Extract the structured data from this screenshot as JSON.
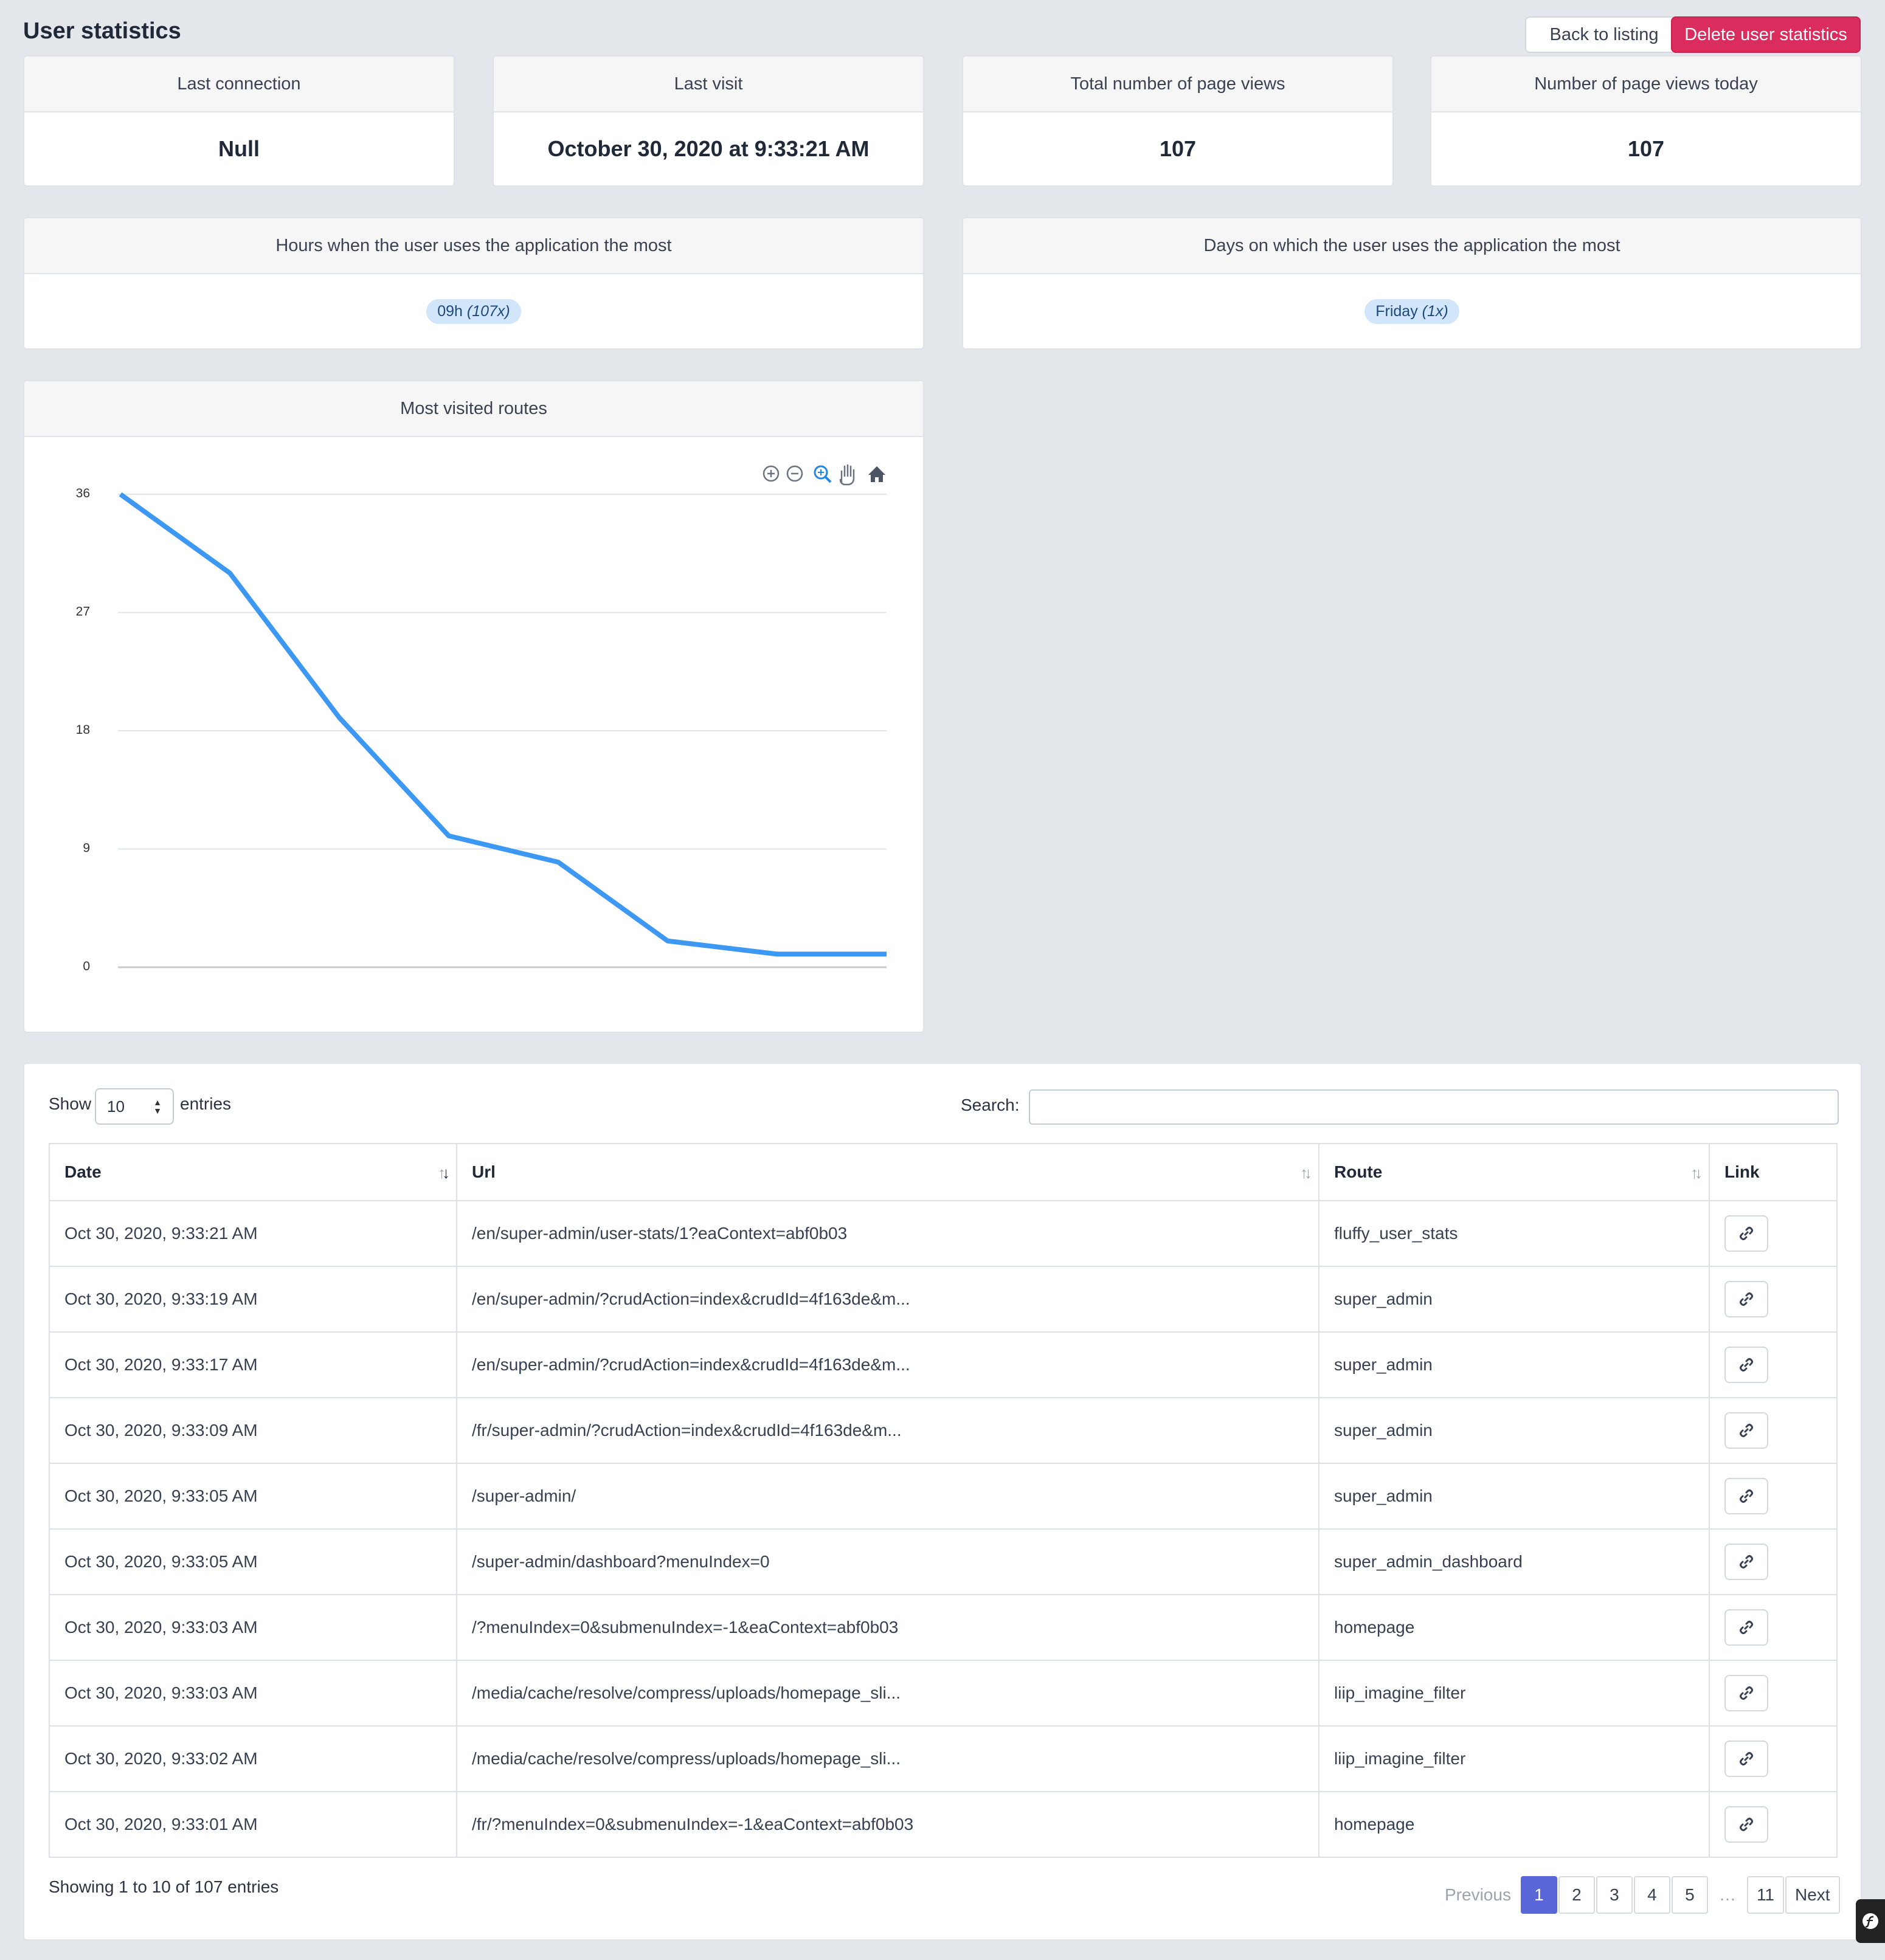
{
  "header": {
    "title": "User statistics",
    "back_label": "Back to listing",
    "delete_label": "Delete user statistics"
  },
  "stats": [
    {
      "label": "Last connection",
      "value": "Null"
    },
    {
      "label": "Last visit",
      "value": "October 30, 2020 at 9:33:21 AM"
    },
    {
      "label": "Total number of page views",
      "value": "107"
    },
    {
      "label": "Number of page views today",
      "value": "107"
    }
  ],
  "hours_card": {
    "title": "Hours when the user uses the application the most",
    "badge_value": "09h",
    "badge_count": "(107x)"
  },
  "days_card": {
    "title": "Days on which the user uses the application the most",
    "badge_value": "Friday",
    "badge_count": "(1x)"
  },
  "chart_card": {
    "title": "Most visited routes"
  },
  "chart_data": {
    "type": "line",
    "title": "Most visited routes",
    "x": [
      1,
      2,
      3,
      4,
      5,
      6,
      7,
      8
    ],
    "series": [
      {
        "values": [
          36,
          30,
          19,
          10,
          8,
          2,
          1,
          1
        ],
        "color": "#3c98f2"
      }
    ],
    "yticks": [
      "0",
      "9",
      "18",
      "27",
      "36"
    ],
    "ylim": [
      0,
      36
    ],
    "grid": true,
    "toolbar_icons": [
      "zoom-in-icon",
      "zoom-out-icon",
      "magnifier-icon",
      "pan-hand-icon",
      "home-icon"
    ]
  },
  "table": {
    "show_label": "Show",
    "entries_value": "10",
    "entries_label": "entries",
    "search_label": "Search:",
    "columns": [
      "Date",
      "Url",
      "Route",
      "Link"
    ],
    "rows": [
      {
        "date": "Oct 30, 2020, 9:33:21 AM",
        "url": "/en/super-admin/user-stats/1?eaContext=abf0b03",
        "route": "fluffy_user_stats"
      },
      {
        "date": "Oct 30, 2020, 9:33:19 AM",
        "url": "/en/super-admin/?crudAction=index&crudId=4f163de&m...",
        "route": "super_admin"
      },
      {
        "date": "Oct 30, 2020, 9:33:17 AM",
        "url": "/en/super-admin/?crudAction=index&crudId=4f163de&m...",
        "route": "super_admin"
      },
      {
        "date": "Oct 30, 2020, 9:33:09 AM",
        "url": "/fr/super-admin/?crudAction=index&crudId=4f163de&m...",
        "route": "super_admin"
      },
      {
        "date": "Oct 30, 2020, 9:33:05 AM",
        "url": "/super-admin/",
        "route": "super_admin"
      },
      {
        "date": "Oct 30, 2020, 9:33:05 AM",
        "url": "/super-admin/dashboard?menuIndex=0",
        "route": "super_admin_dashboard"
      },
      {
        "date": "Oct 30, 2020, 9:33:03 AM",
        "url": "/?menuIndex=0&submenuIndex=-1&eaContext=abf0b03",
        "route": "homepage"
      },
      {
        "date": "Oct 30, 2020, 9:33:03 AM",
        "url": "/media/cache/resolve/compress/uploads/homepage_sli...",
        "route": "liip_imagine_filter"
      },
      {
        "date": "Oct 30, 2020, 9:33:02 AM",
        "url": "/media/cache/resolve/compress/uploads/homepage_sli...",
        "route": "liip_imagine_filter"
      },
      {
        "date": "Oct 30, 2020, 9:33:01 AM",
        "url": "/fr/?menuIndex=0&submenuIndex=-1&eaContext=abf0b03",
        "route": "homepage"
      }
    ],
    "info": "Showing 1 to 10 of 107 entries",
    "pagination": {
      "previous": "Previous",
      "pages": [
        "1",
        "2",
        "3",
        "4",
        "5"
      ],
      "ellipsis": "…",
      "last": "11",
      "next": "Next",
      "active": "1"
    }
  },
  "colors": {
    "accent": "#5a67d8",
    "danger": "#db2d5d",
    "line": "#3c98f2",
    "badge_bg": "#d2e6fb"
  }
}
